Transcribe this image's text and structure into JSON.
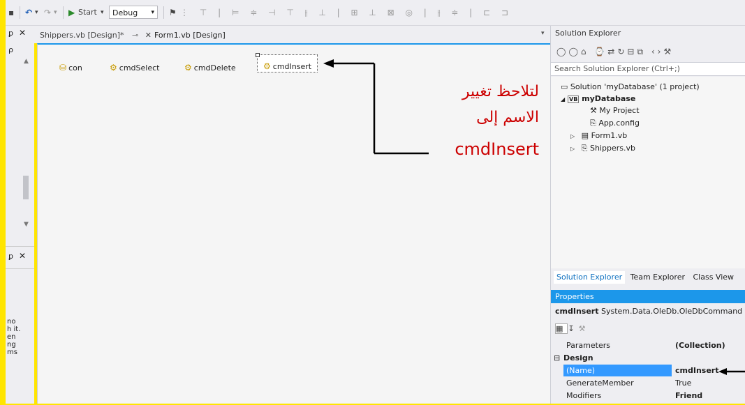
{
  "toolbar": {
    "undo_icon": "undo-icon",
    "start_label": "Start",
    "config_value": "Debug"
  },
  "left_panel": {
    "pin": "p",
    "close": "×",
    "snippet": [
      "no",
      "h it.",
      "en",
      "ng",
      "ms"
    ]
  },
  "doc_tabs": [
    {
      "label": "Shippers.vb [Design]*"
    },
    {
      "label": "Form1.vb [Design]"
    }
  ],
  "components": [
    {
      "label": "con"
    },
    {
      "label": "cmdSelect"
    },
    {
      "label": "cmdDelete"
    },
    {
      "label": "cmdInsert"
    }
  ],
  "annotation": {
    "line1": "لتلاحظ تغيير",
    "line2": "الاسم إلى",
    "line3": "cmdInsert",
    "color": "#cc0000"
  },
  "solution_explorer": {
    "title": "Solution Explorer",
    "search_placeholder": "Search Solution Explorer (Ctrl+;)",
    "tree": [
      {
        "label": "Solution 'myDatabase' (1 project)"
      },
      {
        "label": "myDatabase"
      },
      {
        "label": "My Project"
      },
      {
        "label": "App.config"
      },
      {
        "label": "Form1.vb"
      },
      {
        "label": "Shippers.vb"
      }
    ],
    "bottom_tabs": [
      "Solution Explorer",
      "Team Explorer",
      "Class View"
    ]
  },
  "properties": {
    "title": "Properties",
    "object_name": "cmdInsert",
    "object_type": "System.Data.OleDb.OleDbCommand",
    "rows": [
      {
        "name": "Parameters",
        "value": "(Collection)"
      },
      {
        "name": "Design",
        "value": ""
      },
      {
        "name": "(Name)",
        "value": "cmdInsert"
      },
      {
        "name": "GenerateMember",
        "value": "True"
      },
      {
        "name": "Modifiers",
        "value": "Friend"
      }
    ],
    "accent": "#1c97ea"
  }
}
